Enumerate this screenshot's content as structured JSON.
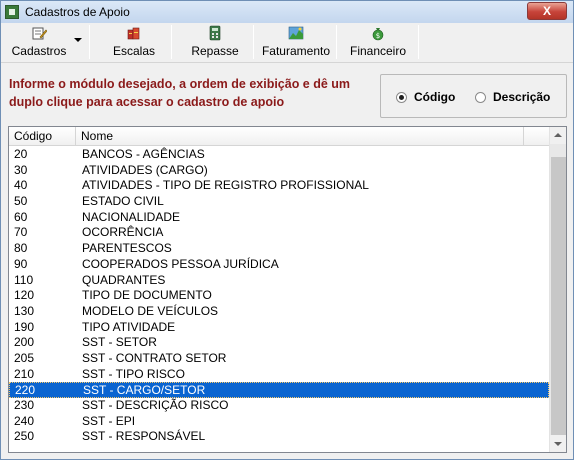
{
  "window": {
    "title": "Cadastros de Apoio",
    "close_label": "X",
    "close_color": "#c7443a"
  },
  "toolbar": {
    "buttons": [
      {
        "label": "Cadastros",
        "icon": "pencil-document-icon",
        "has_dropdown": true
      },
      {
        "label": "Escalas",
        "icon": "books-icon"
      },
      {
        "label": "Repasse",
        "icon": "calculator-icon"
      },
      {
        "label": "Faturamento",
        "icon": "chart-document-icon"
      },
      {
        "label": "Financeiro",
        "icon": "money-bag-icon"
      }
    ]
  },
  "instruction": {
    "text": "Informe o módulo desejado, a ordem de exibição e dê um duplo clique para acessar o cadastro de apoio",
    "color": "#8b1a1a"
  },
  "order_options": {
    "selected": "Código",
    "options": [
      "Código",
      "Descrição"
    ]
  },
  "list": {
    "columns": [
      "Código",
      "Nome"
    ],
    "selected_index": 17,
    "selection_color": "#0a64d0",
    "rows": [
      {
        "code": "20",
        "name": "BANCOS - AGÊNCIAS"
      },
      {
        "code": "30",
        "name": "ATIVIDADES (CARGO)"
      },
      {
        "code": "40",
        "name": "ATIVIDADES - TIPO DE REGISTRO PROFISSIONAL"
      },
      {
        "code": "50",
        "name": "ESTADO CIVIL"
      },
      {
        "code": "60",
        "name": "NACIONALIDADE"
      },
      {
        "code": "70",
        "name": "OCORRÊNCIA"
      },
      {
        "code": "80",
        "name": "PARENTESCOS"
      },
      {
        "code": "90",
        "name": "COOPERADOS PESSOA JURÍDICA"
      },
      {
        "code": "110",
        "name": "QUADRANTES"
      },
      {
        "code": "120",
        "name": "TIPO DE DOCUMENTO"
      },
      {
        "code": "130",
        "name": "MODELO DE VEÍCULOS"
      },
      {
        "code": "190",
        "name": "TIPO ATIVIDADE"
      },
      {
        "code": "200",
        "name": "SST - SETOR"
      },
      {
        "code": "205",
        "name": "SST - CONTRATO SETOR"
      },
      {
        "code": "210",
        "name": "SST - TIPO RISCO"
      },
      {
        "code": "220",
        "name": "SST - CARGO/SETOR"
      },
      {
        "code": "230",
        "name": "SST - DESCRIÇÃO RISCO"
      },
      {
        "code": "240",
        "name": "SST - EPI"
      },
      {
        "code": "250",
        "name": "SST - RESPONSÁVEL"
      }
    ]
  }
}
